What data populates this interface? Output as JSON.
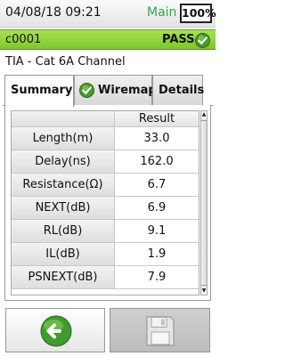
{
  "status": {
    "datetime": "04/08/18 09:21",
    "mode": "Main",
    "battery": "100%"
  },
  "job": {
    "id": "c0001",
    "result": "PASS"
  },
  "test": {
    "standard": "TIA - Cat 6A Channel"
  },
  "tabs": [
    {
      "label": "Summary",
      "active": true
    },
    {
      "label": "Wiremap",
      "icon": "check-icon"
    },
    {
      "label": "Details"
    }
  ],
  "table": {
    "header": {
      "name": "",
      "value": "Result"
    },
    "rows": [
      {
        "name": "Length(m)",
        "value": "33.0"
      },
      {
        "name": "Delay(ns)",
        "value": "162.0"
      },
      {
        "name": "Resistance(Ω)",
        "value": "6.7"
      },
      {
        "name": "NEXT(dB)",
        "value": "6.9"
      },
      {
        "name": "RL(dB)",
        "value": "9.1"
      },
      {
        "name": "IL(dB)",
        "value": "1.9"
      },
      {
        "name": "PSNEXT(dB)",
        "value": "7.9"
      }
    ]
  },
  "buttons": {
    "back": "back-arrow-icon",
    "save": "save-disk-icon"
  },
  "colors": {
    "pass_green": "#7fc62a",
    "mode_text": "#2fa84a"
  }
}
